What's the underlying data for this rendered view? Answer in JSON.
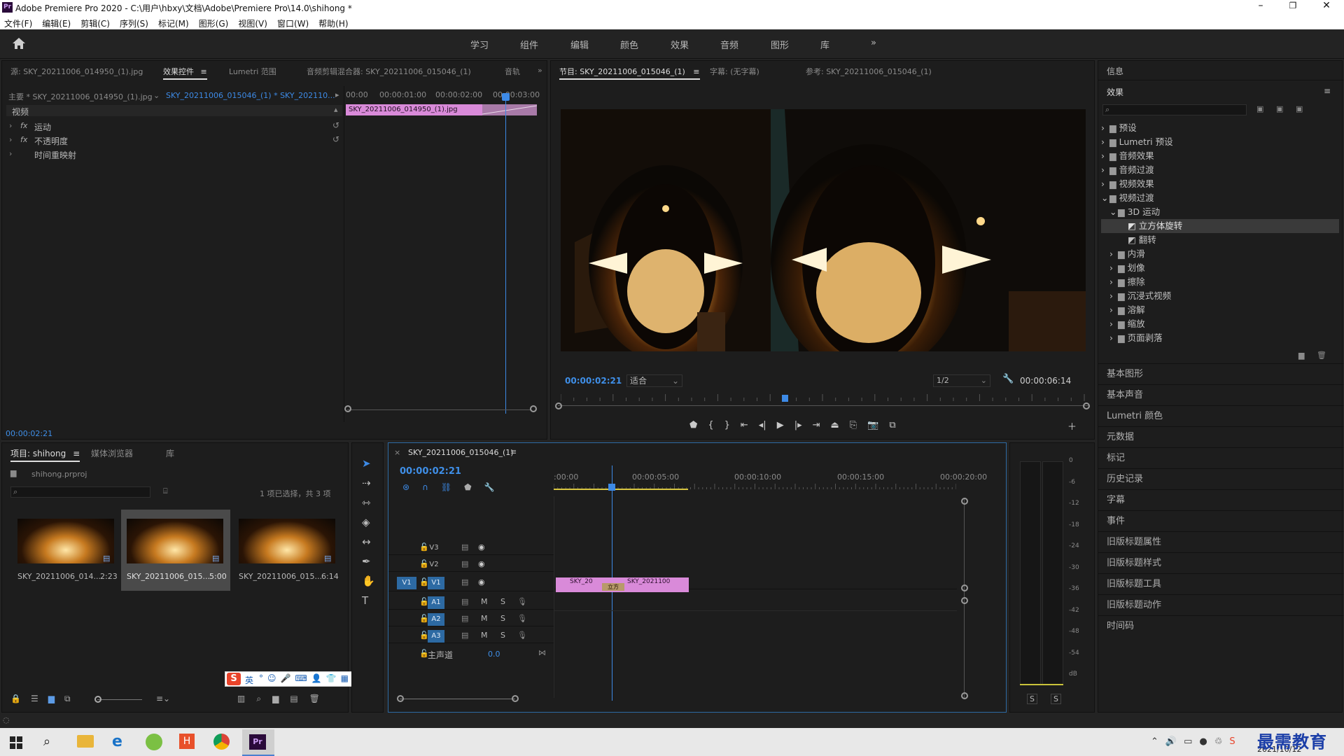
{
  "app": {
    "title": "Adobe Premiere Pro 2020 - C:\\用户\\hbxy\\文档\\Adobe\\Premiere Pro\\14.0\\shihong *"
  },
  "menu": [
    "文件(F)",
    "编辑(E)",
    "剪辑(C)",
    "序列(S)",
    "标记(M)",
    "图形(G)",
    "视图(V)",
    "窗口(W)",
    "帮助(H)"
  ],
  "workspaces": [
    "学习",
    "组件",
    "编辑",
    "颜色",
    "效果",
    "音频",
    "图形",
    "库"
  ],
  "ws_more": "»",
  "src_tabs": {
    "source": "源: SKY_20211006_014950_(1).jpg",
    "effect_controls": "效果控件",
    "lumetri": "Lumetri 范围",
    "audio_mixer": "音频剪辑混合器: SKY_20211006_015046_(1)",
    "audio_short": "音轨"
  },
  "ec": {
    "master": "主要 * SKY_20211006_014950_(1).jpg",
    "seq": "SKY_20211006_015046_(1) * SKY_202110...",
    "section": "视频",
    "props": [
      "运动",
      "不透明度",
      "时间重映射"
    ],
    "fx": "fx",
    "ruler": [
      "00:00",
      "00:00:01:00",
      "00:00:02:00",
      "00:00:03:00"
    ],
    "clip": "SKY_20211006_014950_(1).jpg",
    "time": "00:00:02:21"
  },
  "program": {
    "tabs": [
      "节目: SKY_20211006_015046_(1)",
      "字幕: (无字幕)",
      "参考: SKY_20211006_015046_(1)"
    ],
    "timecode": "00:00:02:21",
    "fit": "适合",
    "res": "1/2",
    "duration": "00:00:06:14"
  },
  "info_title": "信息",
  "effects": {
    "title": "效果",
    "search_placeholder": "",
    "tree": [
      "预设",
      "Lumetri 预设",
      "音频效果",
      "音频过渡",
      "视频效果",
      "视频过渡",
      "3D 运动",
      "立方体旋转",
      "翻转",
      "内滑",
      "划像",
      "擦除",
      "沉浸式视频",
      "溶解",
      "缩放",
      "页面剥落"
    ]
  },
  "right_panels": [
    "基本图形",
    "基本声音",
    "Lumetri 颜色",
    "元数据",
    "标记",
    "历史记录",
    "字幕",
    "事件",
    "旧版标题属性",
    "旧版标题样式",
    "旧版标题工具",
    "旧版标题动作",
    "时间码"
  ],
  "project": {
    "tabs": [
      "项目: shihong",
      "媒体浏览器",
      "库"
    ],
    "file": "shihong.prproj",
    "selection": "1 项已选择，共 3 项",
    "items": [
      {
        "name": "SKY_20211006_014...",
        "dur": "2:23"
      },
      {
        "name": "SKY_20211006_015...",
        "dur": "5:00"
      },
      {
        "name": "SKY_20211006_015...",
        "dur": "6:14"
      }
    ]
  },
  "ime": {
    "label": "英"
  },
  "timeline": {
    "title": "SKY_20211006_015046_(1)",
    "timecode": "00:00:02:21",
    "ruler": [
      ":00:00",
      "00:00:05:00",
      "00:00:10:00",
      "00:00:15:00",
      "00:00:20:00"
    ],
    "video_tracks": [
      "V3",
      "V2",
      "V1"
    ],
    "audio_tracks": [
      "A1",
      "A2",
      "A3"
    ],
    "src_v": "V1",
    "master": "主声道",
    "master_val": "0.0",
    "clip1": "SKY_20",
    "clip2": "SKY_2021100",
    "transition": "立方",
    "m": "M",
    "s": "S"
  },
  "meter": {
    "scale": [
      "0",
      "-6",
      "-12",
      "-18",
      "-24",
      "-30",
      "-36",
      "-42",
      "-48",
      "-54",
      "dB"
    ],
    "solo": [
      "S",
      "S"
    ]
  },
  "taskbar": {
    "time": "2021/10/12",
    "watermark": "最需教育"
  },
  "colors": {
    "accent": "#3d8ae6",
    "clip": "#d98ad9",
    "bg": "#1d1d1d"
  }
}
